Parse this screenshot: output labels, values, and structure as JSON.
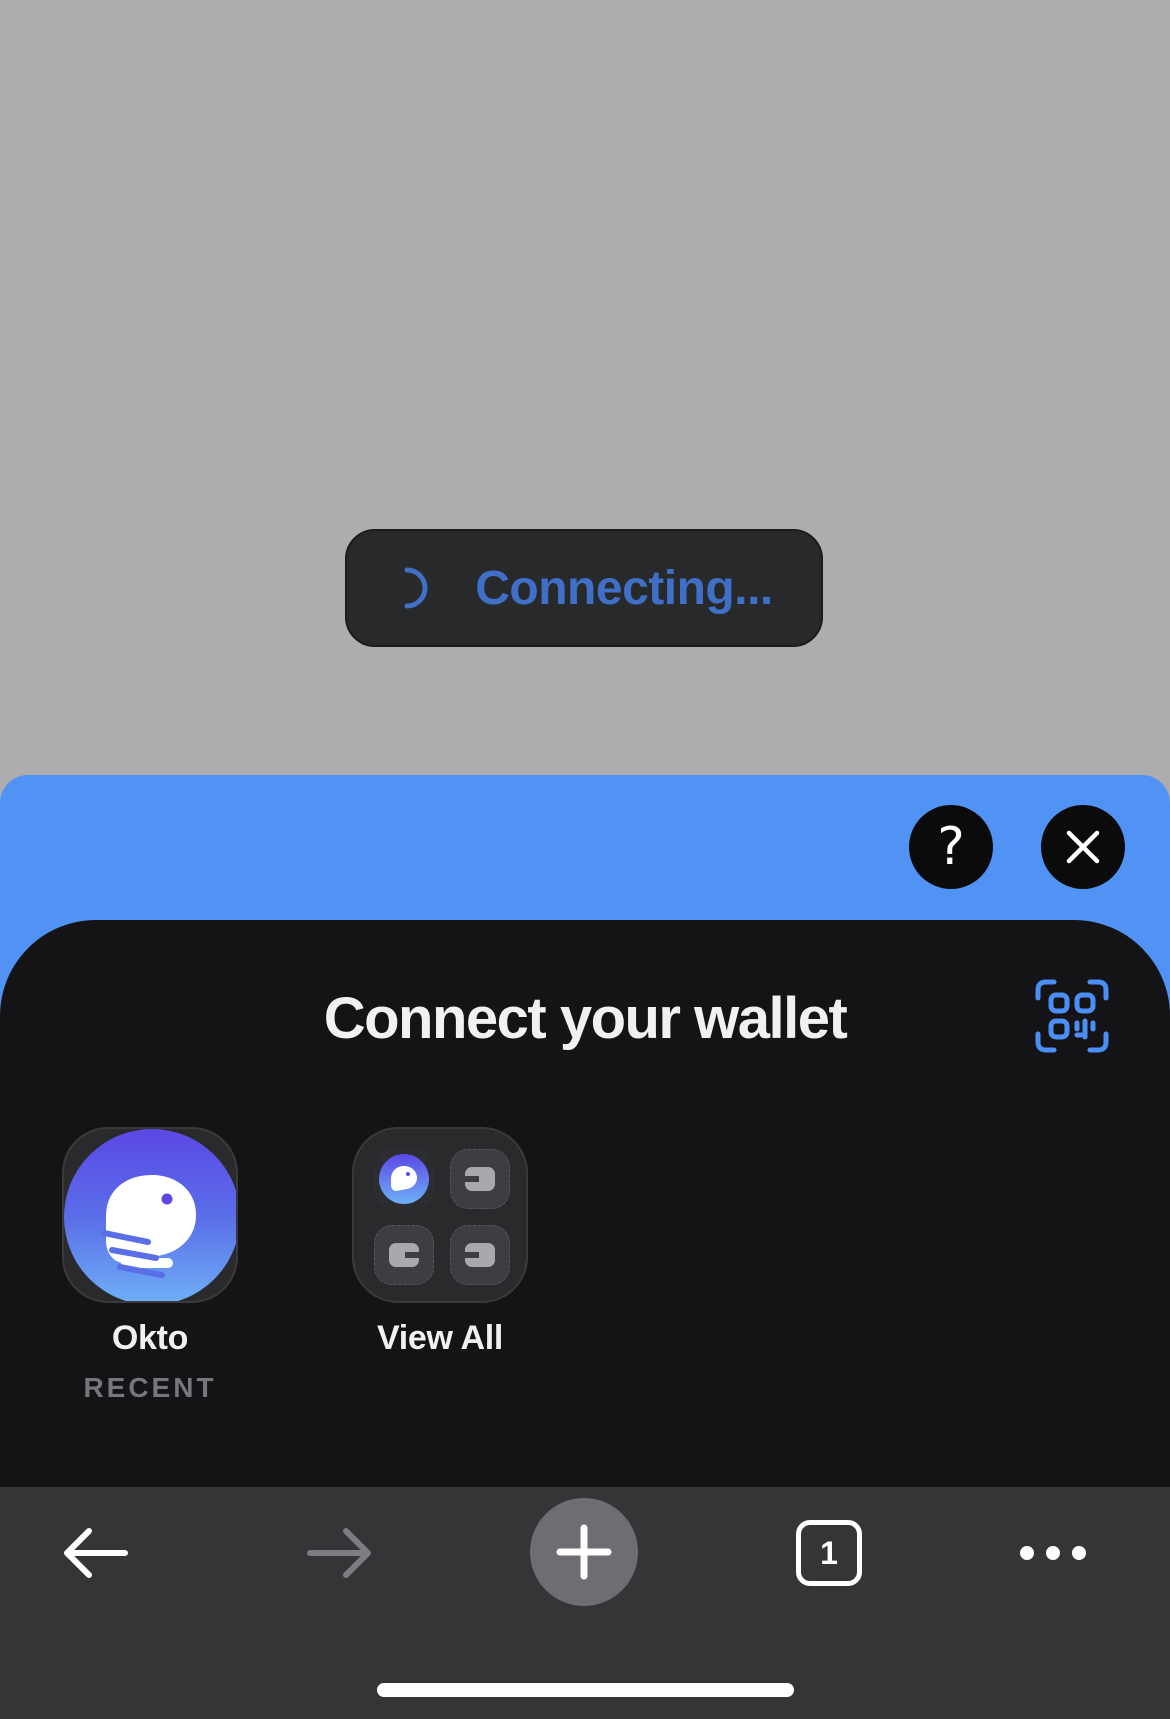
{
  "toast": {
    "status": "Connecting...",
    "icon": "loading-spinner-icon"
  },
  "sheet": {
    "help_icon": "question-mark-icon",
    "close_icon": "close-icon",
    "title": "Connect your wallet",
    "scan_icon": "qr-scan-icon"
  },
  "wallets": [
    {
      "name": "Okto",
      "tag": "RECENT",
      "icon": "okto-logo-icon"
    },
    {
      "name": "View All",
      "icon": "wallet-grid-icon"
    }
  ],
  "toolbar": {
    "back_icon": "arrow-left-icon",
    "forward_icon": "arrow-right-icon",
    "new_tab_icon": "plus-icon",
    "tab_count": "1",
    "more_icon": "more-dots-icon"
  },
  "colors": {
    "backdrop": "#adadaf",
    "toast_bg": "#28292b",
    "toast_text": "#3f6fc6",
    "sheet_accent": "#5193f4",
    "panel_bg": "#141416",
    "toolbar_bg": "#353538"
  }
}
